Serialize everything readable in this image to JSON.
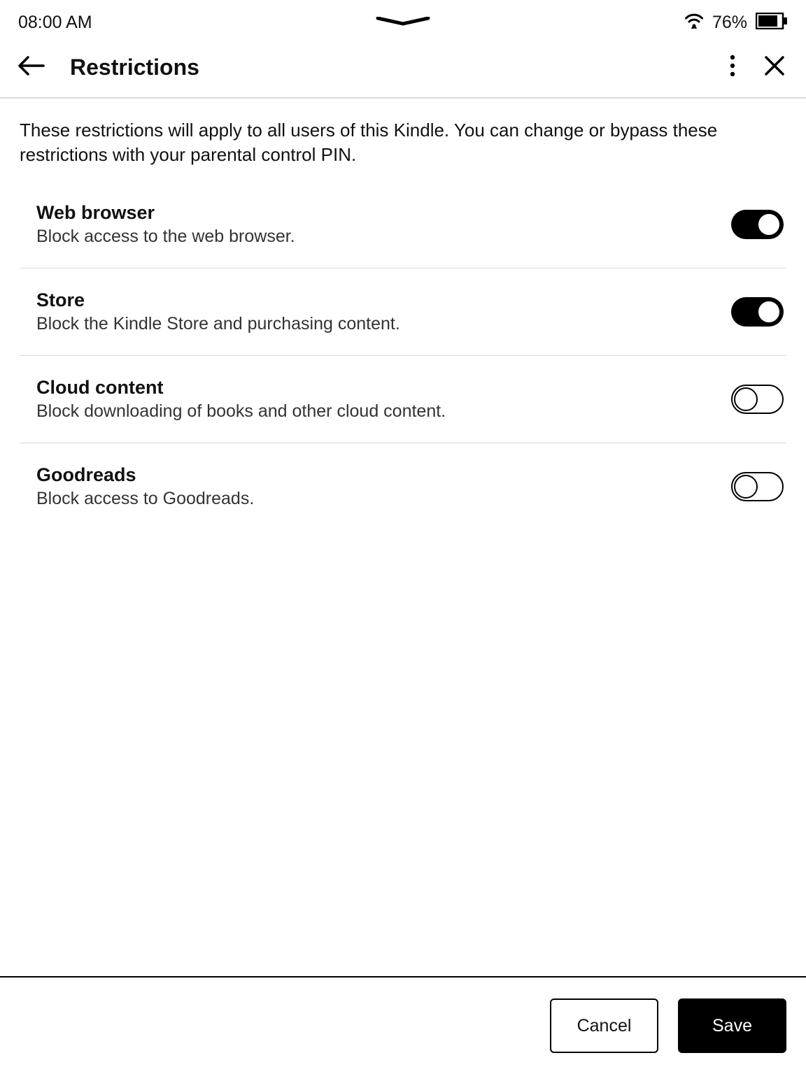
{
  "status": {
    "time": "08:00 AM",
    "battery": "76%"
  },
  "header": {
    "title": "Restrictions"
  },
  "description": "These restrictions will apply to all users of this Kindle. You can change or bypass these restrictions with your parental control PIN.",
  "items": [
    {
      "title": "Web browser",
      "desc": "Block access to the web browser.",
      "on": true
    },
    {
      "title": "Store",
      "desc": "Block the Kindle Store and purchasing content.",
      "on": true
    },
    {
      "title": "Cloud content",
      "desc": "Block downloading of books and other cloud content.",
      "on": false
    },
    {
      "title": "Goodreads",
      "desc": "Block access to Goodreads.",
      "on": false
    }
  ],
  "footer": {
    "cancel": "Cancel",
    "save": "Save"
  }
}
